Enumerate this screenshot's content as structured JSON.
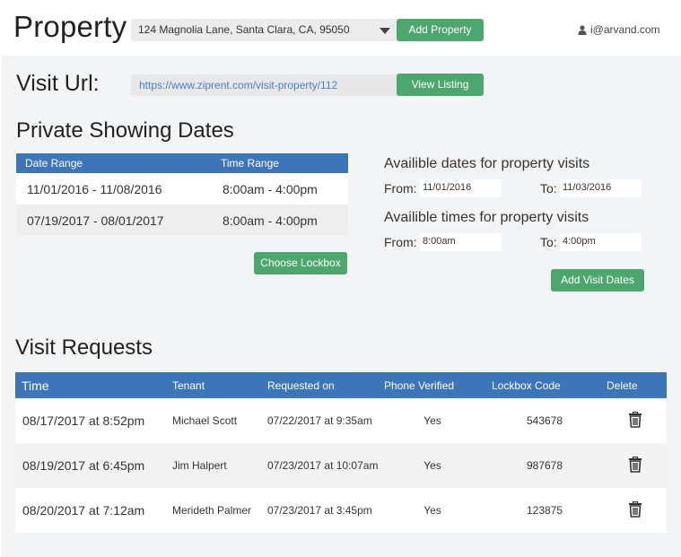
{
  "header": {
    "title": "Property",
    "property_select_value": "124 Magnolia Lane, Santa Clara, CA, 95050",
    "add_property_label": "Add Property",
    "user_email": "i@arvand.com",
    "user_icon": "user-icon"
  },
  "visit": {
    "label": "Visit Url:",
    "url": "https://www.ziprent.com/visit-property/112",
    "view_listing_label": "View Listing"
  },
  "showing": {
    "title": "Private Showing Dates",
    "columns": [
      "Date Range",
      "Time Range"
    ],
    "rows": [
      {
        "date_range": "11/01/2016 - 11/08/2016",
        "time_range": "8:00am - 4:00pm"
      },
      {
        "date_range": "07/19/2017 - 08/01/2017",
        "time_range": "8:00am - 4:00pm"
      }
    ],
    "choose_lockbox_label": "Choose Lockbox"
  },
  "availability": {
    "dates_label": "Availible dates for property visits",
    "dates_from_label": "From:",
    "dates_from_value": "11/01/2016",
    "dates_to_label": "To:",
    "dates_to_value": "11/03/2016",
    "times_label": "Availible times for property visits",
    "times_from_label": "From:",
    "times_from_value": "8:00am",
    "times_to_label": "To:",
    "times_to_value": "4:00pm",
    "add_visit_dates_label": "Add Visit Dates"
  },
  "requests": {
    "title": "Visit Requests",
    "columns": [
      "Time",
      "Tenant",
      "Requested on",
      "Phone Verified",
      "Lockbox Code",
      "Delete"
    ],
    "rows": [
      {
        "time": "08/17/2017 at 8:52pm",
        "tenant": "Michael Scott",
        "requested_on": "07/22/2017 at 9:35am",
        "phone_verified": "Yes",
        "lockbox_code": "543678"
      },
      {
        "time": "08/19/2017 at 6:45pm",
        "tenant": "Jim Halpert",
        "requested_on": "07/23/2017 at 10:07am",
        "phone_verified": "Yes",
        "lockbox_code": "987678"
      },
      {
        "time": "08/20/2017 at 7:12am",
        "tenant": "Merideth Palmer",
        "requested_on": "07/23/2017 at 3:45pm",
        "phone_verified": "Yes",
        "lockbox_code": "123875"
      }
    ],
    "delete_icon": "trash-icon"
  },
  "colors": {
    "accent_green": "#4da66e",
    "table_header_blue": "#3d76b8",
    "link_blue": "#4a7fc1",
    "panel_bg": "#f3f4f6"
  }
}
